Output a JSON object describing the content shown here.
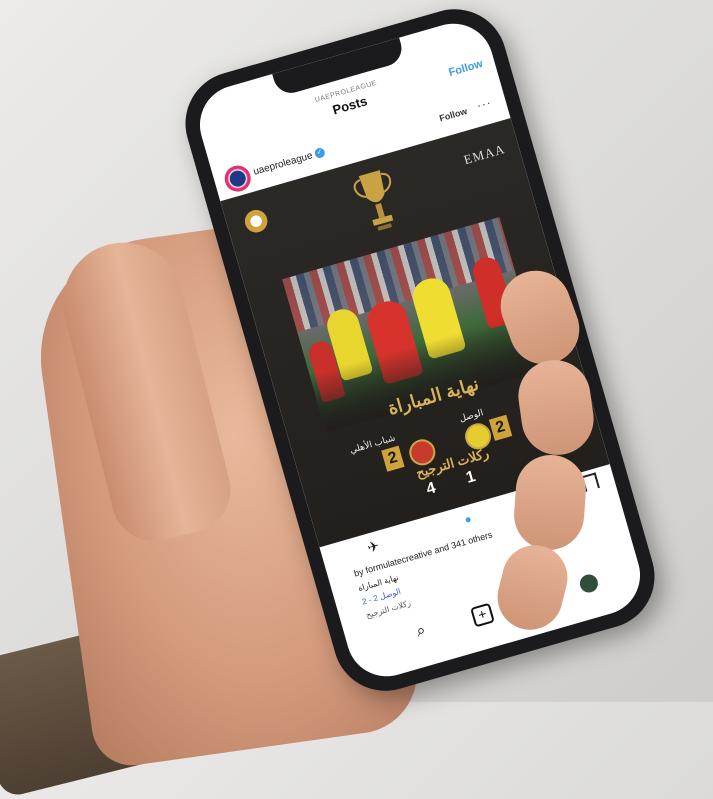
{
  "header": {
    "account_caption": "UAEPROLEAGUE",
    "title": "Posts",
    "follow_label": "Follow"
  },
  "account": {
    "username": "uaeproleague",
    "follow_label": "Follow",
    "more_label": "···"
  },
  "post": {
    "sponsor": "EMAA",
    "end_title": "نهاية المباراة",
    "team_right": {
      "name": "الوصل",
      "score": "2"
    },
    "team_left": {
      "name": "شباب الأهلي",
      "score": "2"
    },
    "penalties_label": "ركلات الترجيح",
    "penalties": [
      "4",
      "1"
    ]
  },
  "actions": {
    "likes_text": "by formulatecreative and 341 others"
  },
  "caption": {
    "line1": "نهاية المباراة",
    "line2": "الوصل 2 - 2",
    "line3": "ركلات الترجيح"
  },
  "tabbar": {
    "search_icon": "search-icon",
    "add_icon": "add-icon",
    "reels_icon": "reels-icon"
  }
}
